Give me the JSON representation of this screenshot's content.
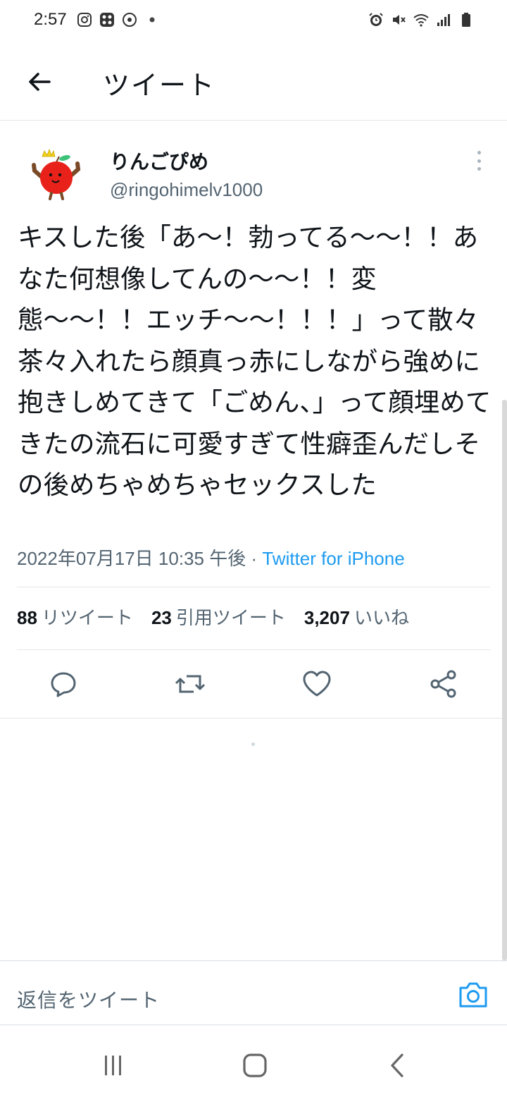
{
  "status_bar": {
    "time": "2:57",
    "left_icons": [
      "instagram-icon",
      "app-grid-icon",
      "sync-icon",
      "dot-icon"
    ],
    "right_icons": [
      "alarm-icon",
      "mute-icon",
      "wifi-icon",
      "signal-icon",
      "battery-icon"
    ]
  },
  "header": {
    "title": "ツイート",
    "back_icon": "arrow-left-icon"
  },
  "tweet": {
    "user": {
      "name": "りんごぴめ",
      "handle": "@ringohimelv1000"
    },
    "text": "キスした後「あ〜！勃ってる〜〜！！あなた何想像してんの〜〜！！変態〜〜！！エッチ〜〜！！！」って散々茶々入れたら顔真っ赤にしながら強めに抱きしめてきて「ごめん、」って顔埋めてきたの流石に可愛すぎて性癖歪んだしその後めちゃめちゃセックスした",
    "timestamp": "2022年07月17日 10:35 午後",
    "separator": "·",
    "source": "Twitter for iPhone",
    "stats": {
      "retweets": {
        "count": "88",
        "label": "リツイート"
      },
      "quotes": {
        "count": "23",
        "label": "引用ツイート"
      },
      "likes": {
        "count": "3,207",
        "label": "いいね"
      }
    }
  },
  "actions": [
    "reply-icon",
    "retweet-icon",
    "like-icon",
    "share-icon"
  ],
  "reply_bar": {
    "placeholder": "返信をツイート",
    "camera_icon": "camera-icon"
  },
  "nav_bar": [
    "recent-apps-icon",
    "home-icon",
    "back-icon"
  ],
  "colors": {
    "accent": "#1d9bf0",
    "text_primary": "#0f1419",
    "text_secondary": "#536471",
    "divider": "#e6e6e6"
  }
}
